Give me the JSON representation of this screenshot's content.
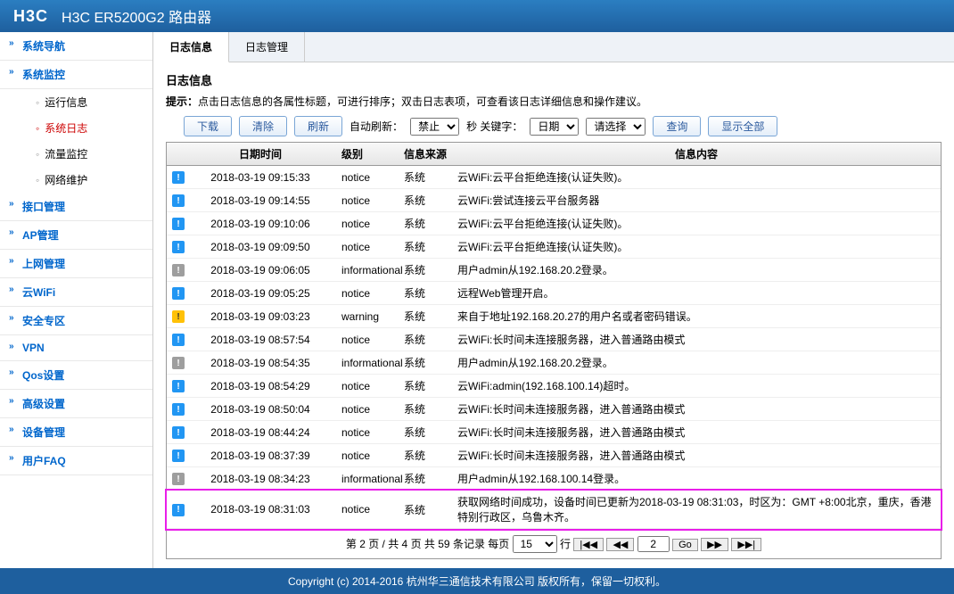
{
  "header": {
    "logo": "H3C",
    "title": "H3C ER5200G2 路由器"
  },
  "sidebar": {
    "items": [
      {
        "label": "系统导航",
        "type": "top"
      },
      {
        "label": "系统监控",
        "type": "top",
        "expanded": true,
        "children": [
          {
            "label": "运行信息"
          },
          {
            "label": "系统日志",
            "active": true
          },
          {
            "label": "流量监控"
          },
          {
            "label": "网络维护"
          }
        ]
      },
      {
        "label": "接口管理",
        "type": "top"
      },
      {
        "label": "AP管理",
        "type": "top"
      },
      {
        "label": "上网管理",
        "type": "top"
      },
      {
        "label": "云WiFi",
        "type": "top"
      },
      {
        "label": "安全专区",
        "type": "top"
      },
      {
        "label": "VPN",
        "type": "top"
      },
      {
        "label": "Qos设置",
        "type": "top"
      },
      {
        "label": "高级设置",
        "type": "top"
      },
      {
        "label": "设备管理",
        "type": "top"
      },
      {
        "label": "用户FAQ",
        "type": "top"
      }
    ]
  },
  "tabs": [
    {
      "label": "日志信息",
      "active": true
    },
    {
      "label": "日志管理"
    }
  ],
  "panel": {
    "title": "日志信息",
    "hint_label": "提示：",
    "hint_text": "点击日志信息的各属性标题，可进行排序；双击日志表项，可查看该日志详细信息和操作建议。",
    "buttons": {
      "download": "下载",
      "clear": "清除",
      "refresh": "刷新",
      "query": "查询",
      "showall": "显示全部"
    },
    "autorefresh_label": "自动刷新：",
    "autorefresh_value": "禁止",
    "sec_label": "秒 关键字：",
    "key_field": "日期",
    "key_value": "请选择"
  },
  "table": {
    "headers": {
      "date": "日期时间",
      "level": "级别",
      "src": "信息来源",
      "msg": "信息内容"
    },
    "rows": [
      {
        "icon": "blue",
        "date": "2018-03-19 09:15:33",
        "level": "notice",
        "src": "系统",
        "msg": "云WiFi:云平台拒绝连接(认证失败)。"
      },
      {
        "icon": "blue",
        "date": "2018-03-19 09:14:55",
        "level": "notice",
        "src": "系统",
        "msg": "云WiFi:尝试连接云平台服务器"
      },
      {
        "icon": "blue",
        "date": "2018-03-19 09:10:06",
        "level": "notice",
        "src": "系统",
        "msg": "云WiFi:云平台拒绝连接(认证失败)。"
      },
      {
        "icon": "blue",
        "date": "2018-03-19 09:09:50",
        "level": "notice",
        "src": "系统",
        "msg": "云WiFi:云平台拒绝连接(认证失败)。"
      },
      {
        "icon": "gray",
        "date": "2018-03-19 09:06:05",
        "level": "informational",
        "src": "系统",
        "msg": "用户admin从192.168.20.2登录。"
      },
      {
        "icon": "blue",
        "date": "2018-03-19 09:05:25",
        "level": "notice",
        "src": "系统",
        "msg": "远程Web管理开启。"
      },
      {
        "icon": "yellow",
        "date": "2018-03-19 09:03:23",
        "level": "warning",
        "src": "系统",
        "msg": "来自于地址192.168.20.27的用户名或者密码错误。"
      },
      {
        "icon": "blue",
        "date": "2018-03-19 08:57:54",
        "level": "notice",
        "src": "系统",
        "msg": "云WiFi:长时间未连接服务器，进入普通路由模式"
      },
      {
        "icon": "gray",
        "date": "2018-03-19 08:54:35",
        "level": "informational",
        "src": "系统",
        "msg": "用户admin从192.168.20.2登录。"
      },
      {
        "icon": "blue",
        "date": "2018-03-19 08:54:29",
        "level": "notice",
        "src": "系统",
        "msg": "云WiFi:admin(192.168.100.14)超时。"
      },
      {
        "icon": "blue",
        "date": "2018-03-19 08:50:04",
        "level": "notice",
        "src": "系统",
        "msg": "云WiFi:长时间未连接服务器，进入普通路由模式"
      },
      {
        "icon": "blue",
        "date": "2018-03-19 08:44:24",
        "level": "notice",
        "src": "系统",
        "msg": "云WiFi:长时间未连接服务器，进入普通路由模式"
      },
      {
        "icon": "blue",
        "date": "2018-03-19 08:37:39",
        "level": "notice",
        "src": "系统",
        "msg": "云WiFi:长时间未连接服务器，进入普通路由模式"
      },
      {
        "icon": "gray",
        "date": "2018-03-19 08:34:23",
        "level": "informational",
        "src": "系统",
        "msg": "用户admin从192.168.100.14登录。"
      },
      {
        "icon": "blue",
        "date": "2018-03-19 08:31:03",
        "level": "notice",
        "src": "系统",
        "msg": "获取网络时间成功，设备时间已更新为2018-03-19 08:31:03，时区为：GMT +8:00北京，重庆，香港特别行政区，乌鲁木齐。",
        "highlight": true
      }
    ]
  },
  "pager": {
    "summary_prefix": "第 ",
    "page": "2",
    "summary_mid": " 页 / 共 ",
    "total_pages": "4",
    "summary_mid2": " 页 共 ",
    "total_rows": "59",
    "summary_suffix": " 条记录 每页",
    "per_page": "15",
    "rows_label": "行",
    "goto": "2",
    "go_label": "Go",
    "first": "|◀◀",
    "prev": "◀◀",
    "next": "▶▶",
    "last": "▶▶|"
  },
  "footer": "Copyright (c) 2014-2016 杭州华三通信技术有限公司 版权所有，保留一切权利。"
}
